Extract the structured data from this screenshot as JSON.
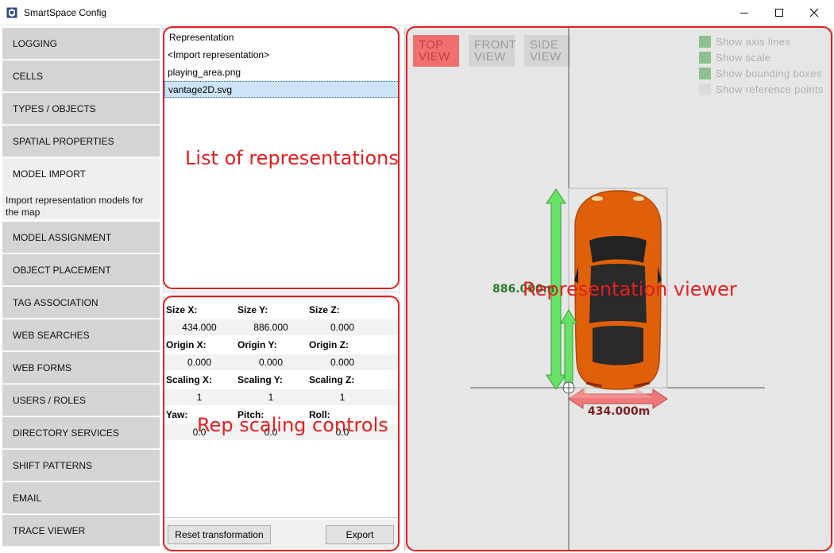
{
  "window": {
    "title": "SmartSpace Config"
  },
  "sidebar": {
    "items": [
      {
        "label": "LOGGING"
      },
      {
        "label": "CELLS"
      },
      {
        "label": "TYPES / OBJECTS"
      },
      {
        "label": "SPATIAL PROPERTIES"
      },
      {
        "label": "MODEL IMPORT"
      },
      {
        "label": "MODEL ASSIGNMENT"
      },
      {
        "label": "OBJECT PLACEMENT"
      },
      {
        "label": "TAG ASSOCIATION"
      },
      {
        "label": "WEB SEARCHES"
      },
      {
        "label": "WEB FORMS"
      },
      {
        "label": "USERS / ROLES"
      },
      {
        "label": "DIRECTORY SERVICES"
      },
      {
        "label": "SHIFT PATTERNS"
      },
      {
        "label": "EMAIL"
      },
      {
        "label": "TRACE VIEWER"
      }
    ],
    "active_description": "Import representation models for the map"
  },
  "representations": {
    "header": "Representation",
    "items": [
      {
        "label": "<Import representation>"
      },
      {
        "label": "playing_area.png"
      },
      {
        "label": "vantage2D.svg"
      }
    ],
    "selected_index": 2
  },
  "scaling": {
    "size_x_label": "Size X:",
    "size_y_label": "Size Y:",
    "size_z_label": "Size Z:",
    "size_x": "434.000",
    "size_y": "886.000",
    "size_z": "0.000",
    "origin_x_label": "Origin X:",
    "origin_y_label": "Origin Y:",
    "origin_z_label": "Origin Z:",
    "origin_x": "0.000",
    "origin_y": "0.000",
    "origin_z": "0.000",
    "scaling_x_label": "Scaling X:",
    "scaling_y_label": "Scaling Y:",
    "scaling_z_label": "Scaling Z:",
    "scaling_x": "1",
    "scaling_y": "1",
    "scaling_z": "1",
    "yaw_label": "Yaw:",
    "pitch_label": "Pitch:",
    "roll_label": "Roll:",
    "yaw": "0.0",
    "pitch": "0.0",
    "roll": "0.0",
    "reset_label": "Reset transformation",
    "export_label": "Export"
  },
  "viewer": {
    "views": [
      {
        "label": "TOP VIEW"
      },
      {
        "label": "FRONT VIEW"
      },
      {
        "label": "SIDE VIEW"
      }
    ],
    "active_view": 0,
    "options": [
      {
        "label": "Show axis lines",
        "checked": true
      },
      {
        "label": "Show scale",
        "checked": true
      },
      {
        "label": "Show bounding boxes",
        "checked": true
      },
      {
        "label": "Show reference points",
        "checked": false
      }
    ],
    "height_readout": "886.000m",
    "width_readout": "434.000m",
    "colors": {
      "x_axis_arrow": "#f07878",
      "y_axis_arrow": "#78e878",
      "car_body": "#e0600a"
    }
  },
  "annotations": {
    "list_label": "List of representations",
    "controls_label": "Rep scaling controls",
    "viewer_label": "Representation viewer"
  }
}
